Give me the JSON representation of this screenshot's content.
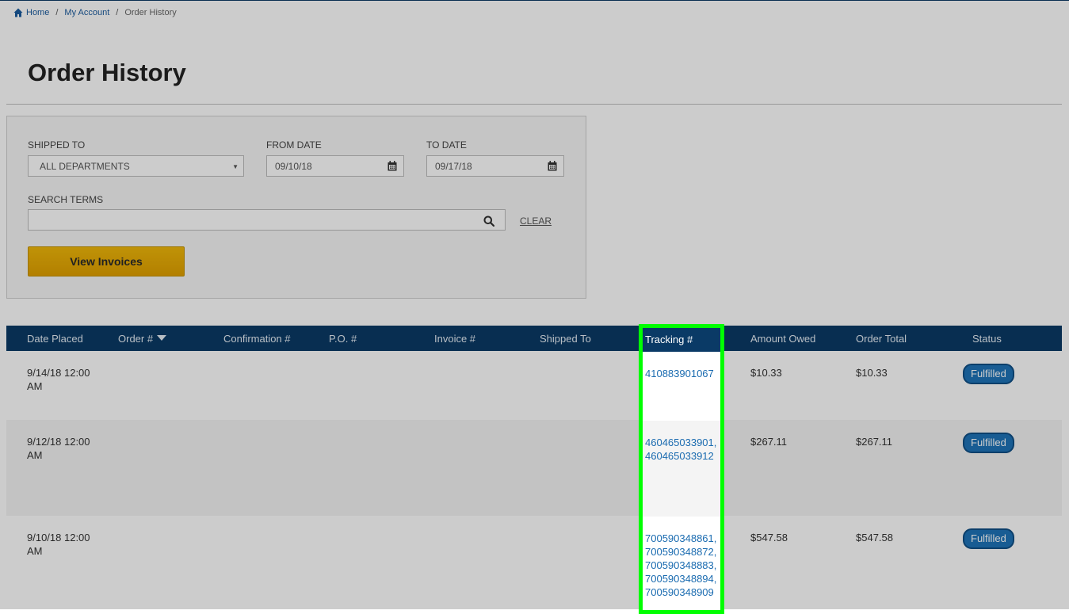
{
  "breadcrumb": {
    "home": "Home",
    "sep": "/",
    "account": "My Account",
    "current": "Order History",
    "home_icon": "home-icon"
  },
  "page_title": "Order History",
  "filters": {
    "shipped_to_label": "SHIPPED TO",
    "shipped_to_value": "ALL DEPARTMENTS",
    "from_date_label": "FROM DATE",
    "from_date_value": "09/10/18",
    "to_date_label": "TO DATE",
    "to_date_value": "09/17/18",
    "search_terms_label": "SEARCH TERMS",
    "search_value": "",
    "clear_label": "CLEAR",
    "view_invoices_label": "View Invoices"
  },
  "table": {
    "columns": [
      "Date Placed",
      "Order #",
      "Confirmation #",
      "P.O. #",
      "Invoice #",
      "Shipped To",
      "Tracking #",
      "Amount Owed",
      "Order Total",
      "Status"
    ],
    "rows": [
      {
        "date_line1": "9/14/18 12:00",
        "date_line2": "AM",
        "tracking": [
          "410883901067"
        ],
        "amount_owed": "$10.33",
        "order_total": "$10.33",
        "status": "Fulfilled"
      },
      {
        "date_line1": "9/12/18 12:00",
        "date_line2": "AM",
        "tracking": [
          "460465033901,",
          "460465033912"
        ],
        "amount_owed": "$267.11",
        "order_total": "$267.11",
        "status": "Fulfilled"
      },
      {
        "date_line1": "9/10/18 12:00",
        "date_line2": "AM",
        "tracking": [
          "700590348861,",
          "700590348872,",
          "700590348883,",
          "700590348894,",
          "700590348909"
        ],
        "amount_owed": "$547.58",
        "order_total": "$547.58",
        "status": "Fulfilled"
      }
    ]
  },
  "colors": {
    "header_bg": "#0a3a66",
    "highlight": "#00ff00",
    "badge": "#1f74b8",
    "button": "#e8ac05",
    "link": "#1a6bb0"
  }
}
